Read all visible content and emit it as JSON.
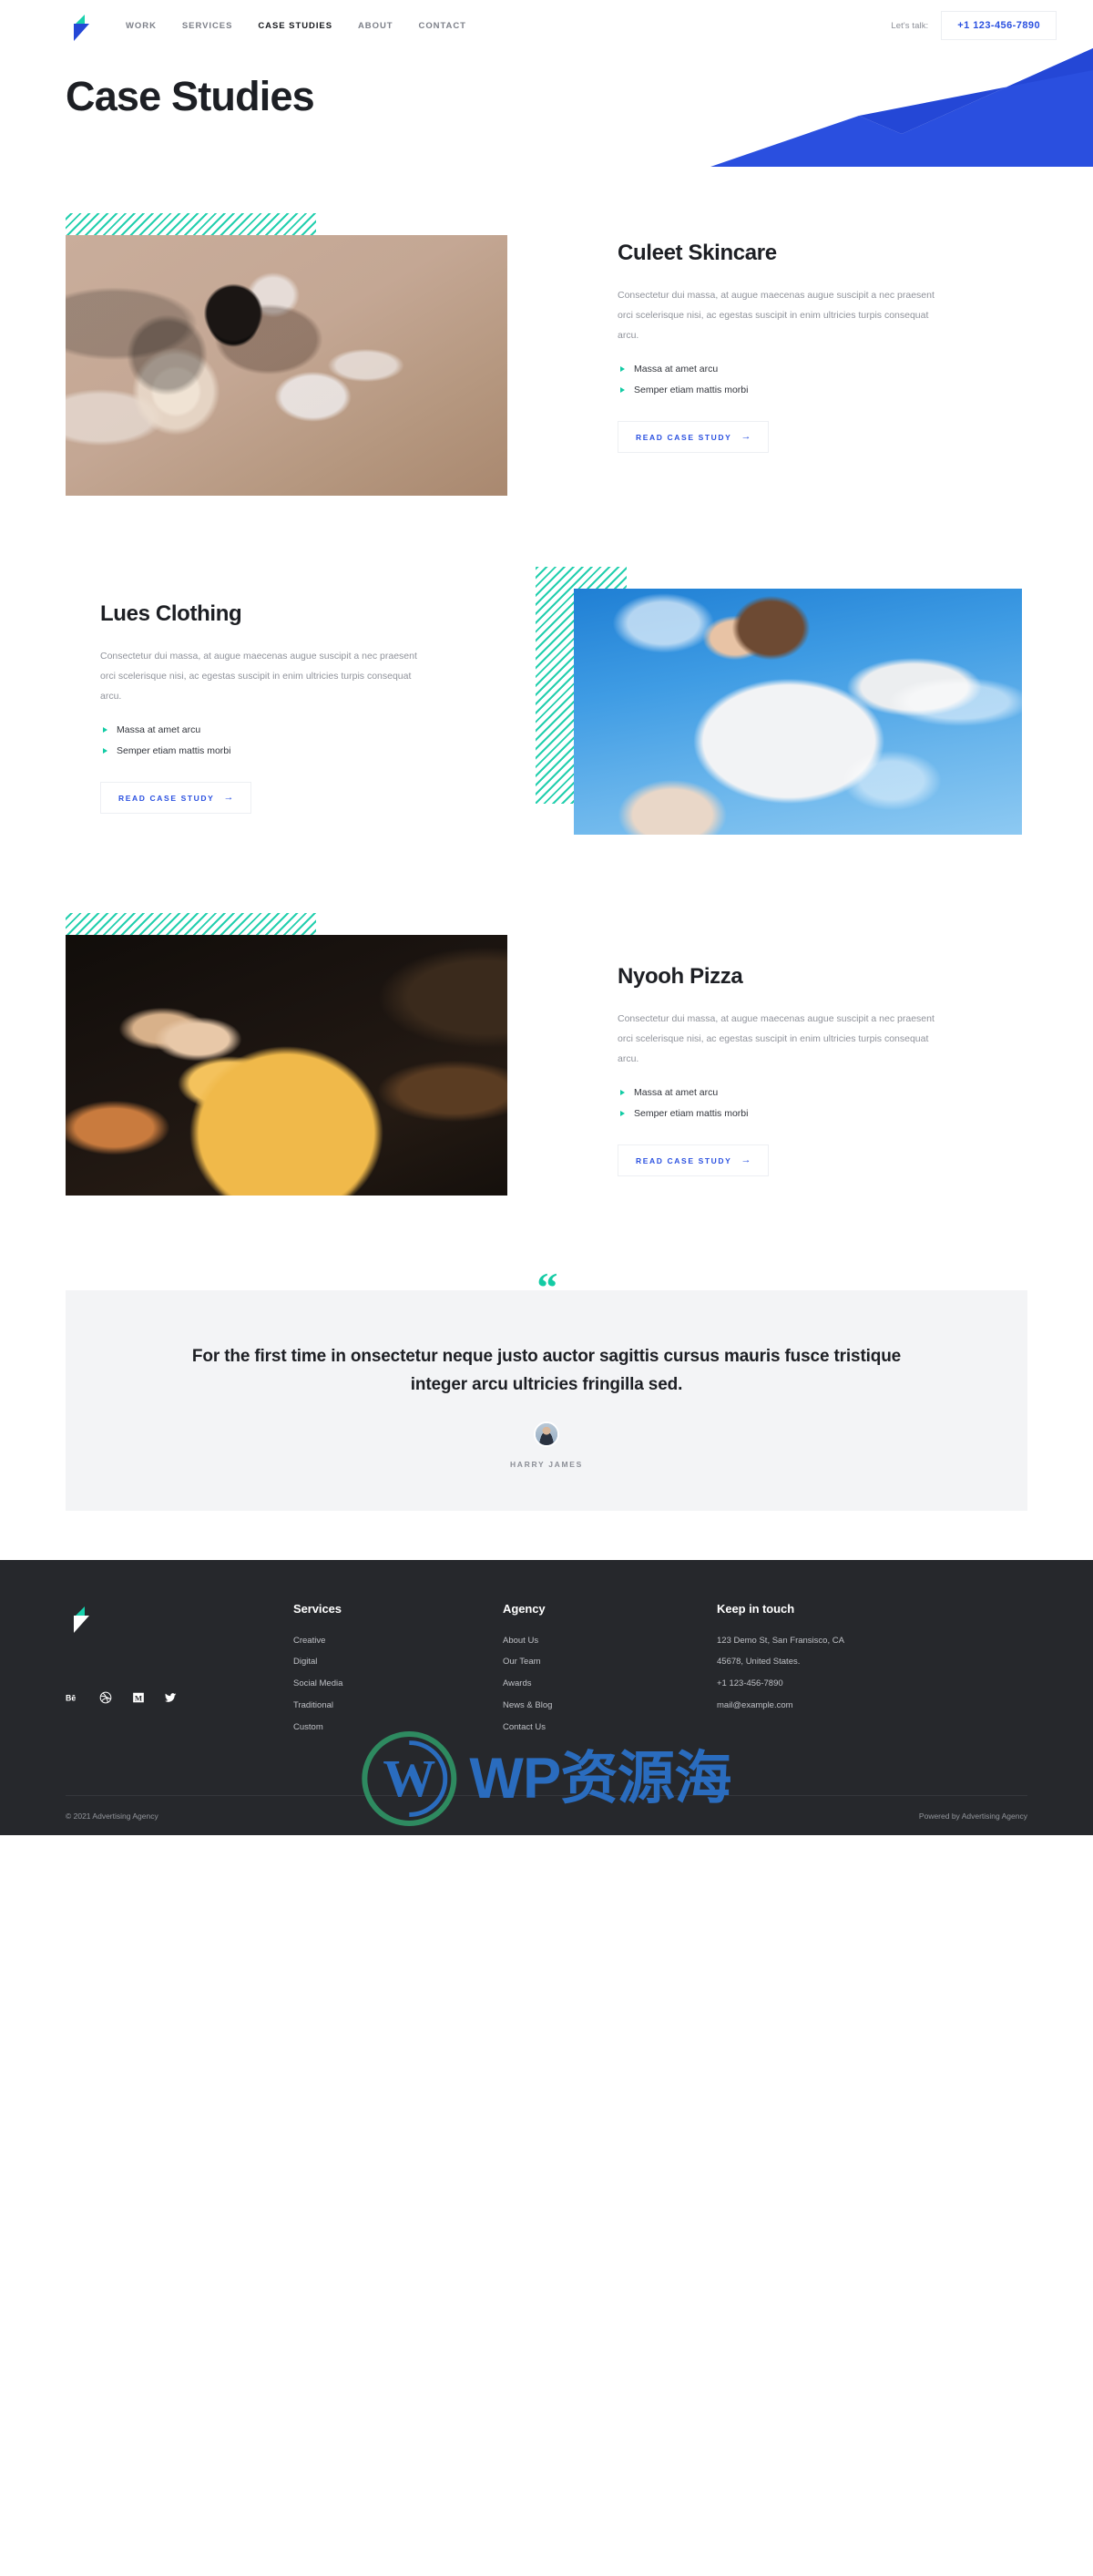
{
  "header": {
    "logo_name": "agency-logo",
    "nav": [
      {
        "label": "WORK",
        "active": false
      },
      {
        "label": "SERVICES",
        "active": false
      },
      {
        "label": "CASE STUDIES",
        "active": true
      },
      {
        "label": "ABOUT",
        "active": false
      },
      {
        "label": "CONTACT",
        "active": false
      }
    ],
    "lets_talk_label": "Let's talk:",
    "phone": "+1 123-456-7890"
  },
  "hero": {
    "title": "Case Studies"
  },
  "colors": {
    "brand_blue": "#2a50e0",
    "shape_blue": "#2a4fdf",
    "teal": "#13cba4",
    "dark": "#1d1f24",
    "footer_bg": "#26282c",
    "testimonial_bg": "#f3f4f6"
  },
  "case_studies": [
    {
      "title": "Culeet Skincare",
      "description": "Consectetur dui massa, at augue maecenas augue suscipit a nec praesent orci scelerisque nisi, ac egestas suscipit in enim ultricies turpis consequat arcu.",
      "bullets": [
        "Massa at amet arcu",
        "Semper etiam mattis morbi"
      ],
      "cta": "READ CASE STUDY",
      "cta_arrow": "→",
      "image_alt": "skincare-jars-photo",
      "media_side": "left"
    },
    {
      "title": "Lues Clothing",
      "description": "Consectetur dui massa, at augue maecenas augue suscipit a nec praesent orci scelerisque nisi, ac egestas suscipit in enim ultricies turpis consequat arcu.",
      "bullets": [
        "Massa at amet arcu",
        "Semper etiam mattis morbi"
      ],
      "cta": "READ CASE STUDY",
      "cta_arrow": "→",
      "image_alt": "woman-white-blazer-sky-photo",
      "media_side": "right"
    },
    {
      "title": "Nyooh Pizza",
      "description": "Consectetur dui massa, at augue maecenas augue suscipit a nec praesent orci scelerisque nisi, ac egestas suscipit in enim ultricies turpis consequat arcu.",
      "bullets": [
        "Massa at amet arcu",
        "Semper etiam mattis morbi"
      ],
      "cta": "READ CASE STUDY",
      "cta_arrow": "→",
      "image_alt": "pizza-slice-photo",
      "media_side": "left"
    }
  ],
  "testimonial": {
    "quote_glyph": "“",
    "quote": "For the first time in onsectetur neque justo auctor sagittis cursus mauris fusce tristique integer arcu ultricies fringilla sed.",
    "author": "HARRY JAMES",
    "avatar_alt": "harry-james-avatar"
  },
  "footer": {
    "columns": [
      {
        "heading": "Services",
        "items": [
          "Creative",
          "Digital",
          "Social Media",
          "Traditional",
          "Custom"
        ]
      },
      {
        "heading": "Agency",
        "items": [
          "About Us",
          "Our Team",
          "Awards",
          "News & Blog",
          "Contact Us"
        ]
      }
    ],
    "touch": {
      "heading": "Keep in touch",
      "lines": [
        "123 Demo St, San Fransisco, CA",
        "45678, United States.",
        "+1 123-456-7890",
        "mail@example.com"
      ]
    },
    "socials": [
      {
        "name": "behance-icon",
        "glyph": "Bē"
      },
      {
        "name": "dribbble-icon",
        "glyph": "◉"
      },
      {
        "name": "medium-icon",
        "glyph": "M"
      },
      {
        "name": "twitter-icon",
        "glyph": "🐦"
      }
    ],
    "copyright": "© 2021 Advertising Agency",
    "powered_by": "Powered by Advertising Agency"
  },
  "watermark": {
    "text": "WP资源海"
  }
}
